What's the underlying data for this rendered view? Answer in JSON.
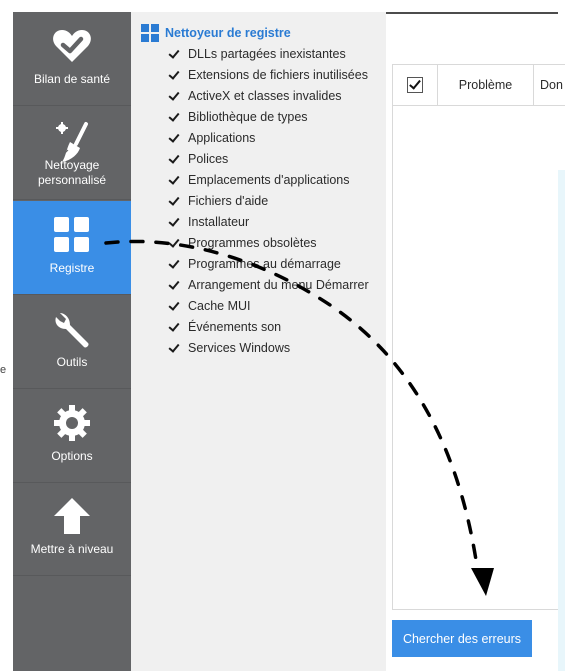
{
  "sidebar": {
    "items": [
      {
        "label": "Bilan de santé",
        "icon": "heart-check-icon"
      },
      {
        "label": "Nettoyage personnalisé",
        "icon": "broom-icon"
      },
      {
        "label": "Registre",
        "icon": "grid-icon",
        "active": true
      },
      {
        "label": "Outils",
        "icon": "wrench-icon"
      },
      {
        "label": "Options",
        "icon": "gear-icon"
      },
      {
        "label": "Mettre à niveau",
        "icon": "arrow-up-icon"
      }
    ]
  },
  "registry": {
    "title": "Nettoyeur de registre",
    "options": [
      "DLLs partagées inexistantes",
      "Extensions de fichiers inutilisées",
      "ActiveX et classes invalides",
      "Bibliothèque de types",
      "Applications",
      "Polices",
      "Emplacements d'applications",
      "Fichiers d'aide",
      "Installateur",
      "Programmes obsolètes",
      "Programmes au démarrage",
      "Arrangement du menu Démarrer",
      "Cache MUI",
      "Événements son",
      "Services Windows"
    ]
  },
  "results": {
    "columns": [
      "Problème",
      "Don"
    ]
  },
  "actions": {
    "scan_label": "Chercher des erreurs"
  },
  "edge_text": "e",
  "colors": {
    "sidebar_bg": "#636466",
    "active_bg": "#3a8ee6",
    "accent_blue": "#2a7bd3",
    "panel_bg": "#f0f0f0"
  }
}
